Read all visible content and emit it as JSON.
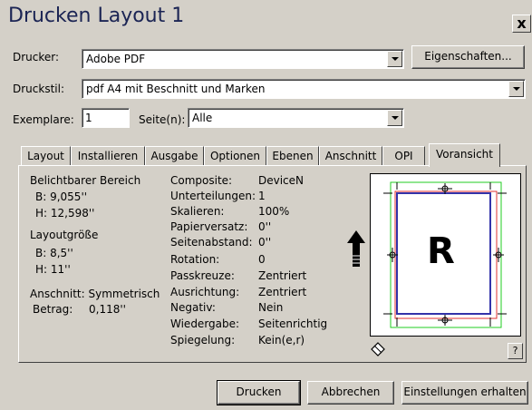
{
  "window": {
    "title": "Drucken Layout 1",
    "close_label": "x"
  },
  "printer": {
    "label": "Drucker:",
    "value": "Adobe PDF",
    "properties_button": "Eigenschaften..."
  },
  "style": {
    "label": "Druckstil:",
    "value": "pdf A4 mit Beschnitt und Marken"
  },
  "copies": {
    "label": "Exemplare:",
    "value": "1"
  },
  "pages": {
    "label": "Seite(n):",
    "value": "Alle"
  },
  "tabs": [
    {
      "label": "Layout"
    },
    {
      "label": "Installieren"
    },
    {
      "label": "Ausgabe"
    },
    {
      "label": "Optionen"
    },
    {
      "label": "Ebenen"
    },
    {
      "label": "Anschnitt"
    },
    {
      "label": "OPI"
    },
    {
      "label": "Voransicht"
    }
  ],
  "active_tab": "Voransicht",
  "summary": {
    "imageable_area_title": "Belichtbarer Bereich",
    "imageable_b": "B: 9,055''",
    "imageable_h": "H: 12,598''",
    "layout_size_title": "Layoutgröße",
    "layout_b": "B: 8,5''",
    "layout_h": "H: 11''",
    "bleed_title": "Anschnitt: Symmetrisch",
    "bleed_amount_label": "Betrag:",
    "bleed_amount_value": "0,118''"
  },
  "details": [
    {
      "label": "Composite:",
      "value": "DeviceN"
    },
    {
      "label": "Unterteilungen:",
      "value": "1"
    },
    {
      "label": "Skalieren:",
      "value": "100%"
    },
    {
      "label": "Papierversatz:",
      "value": "0''"
    },
    {
      "label": "Seitenabstand:",
      "value": "0''"
    },
    {
      "label": "Rotation:",
      "value": "0"
    },
    {
      "label": "Passkreuze:",
      "value": "Zentriert"
    },
    {
      "label": "Ausrichtung:",
      "value": "Zentriert"
    },
    {
      "label": "Negativ:",
      "value": "Nein"
    },
    {
      "label": "Wiedergabe:",
      "value": "Seitenrichtig"
    },
    {
      "label": "Spiegelung:",
      "value": "Kein(e,r)"
    }
  ],
  "preview": {
    "page_letter": "R",
    "help_label": "?"
  },
  "buttons": {
    "print": "Drucken",
    "cancel": "Abbrechen",
    "keep_settings": "Einstellungen erhalten"
  }
}
